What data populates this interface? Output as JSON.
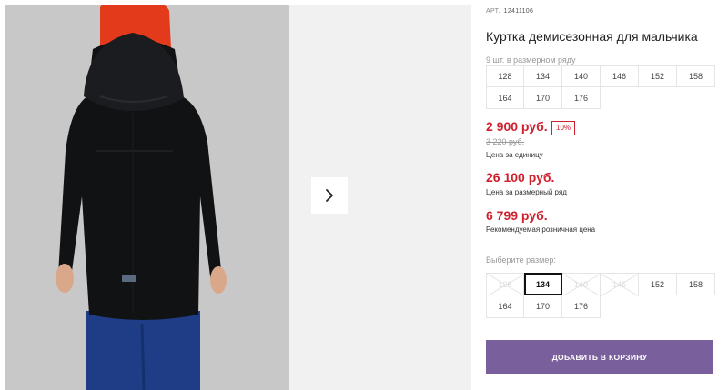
{
  "product": {
    "article_label": "АРТ.",
    "article_number": "12411106",
    "title": "Куртка демисезонная для мальчика",
    "row_info": "9 шт. в размерном ряду",
    "row_sizes": [
      "128",
      "134",
      "140",
      "146",
      "152",
      "158",
      "164",
      "170",
      "176"
    ]
  },
  "pricing": {
    "unit_price": "2 900 руб.",
    "discount": "10%",
    "old_price": "3 220 руб.",
    "unit_label": "Цена за единицу",
    "row_price": "26 100 руб.",
    "row_label": "Цена за размерный ряд",
    "retail_price": "6 799 руб.",
    "retail_label": "Рекомендуемая розничная цена"
  },
  "size_select": {
    "label": "Выберите размер:",
    "selected": "134",
    "options": [
      {
        "size": "128",
        "available": false
      },
      {
        "size": "134",
        "available": true
      },
      {
        "size": "140",
        "available": false
      },
      {
        "size": "146",
        "available": false
      },
      {
        "size": "152",
        "available": true
      },
      {
        "size": "158",
        "available": true
      },
      {
        "size": "164",
        "available": true
      },
      {
        "size": "170",
        "available": true
      },
      {
        "size": "176",
        "available": true
      }
    ]
  },
  "actions": {
    "add_to_cart": "ДОБАВИТЬ В КОРЗИНУ"
  },
  "icons": {
    "next": "chevron-right-icon"
  },
  "colors": {
    "price_red": "#d0202e",
    "button_purple": "#7a5f9d"
  }
}
